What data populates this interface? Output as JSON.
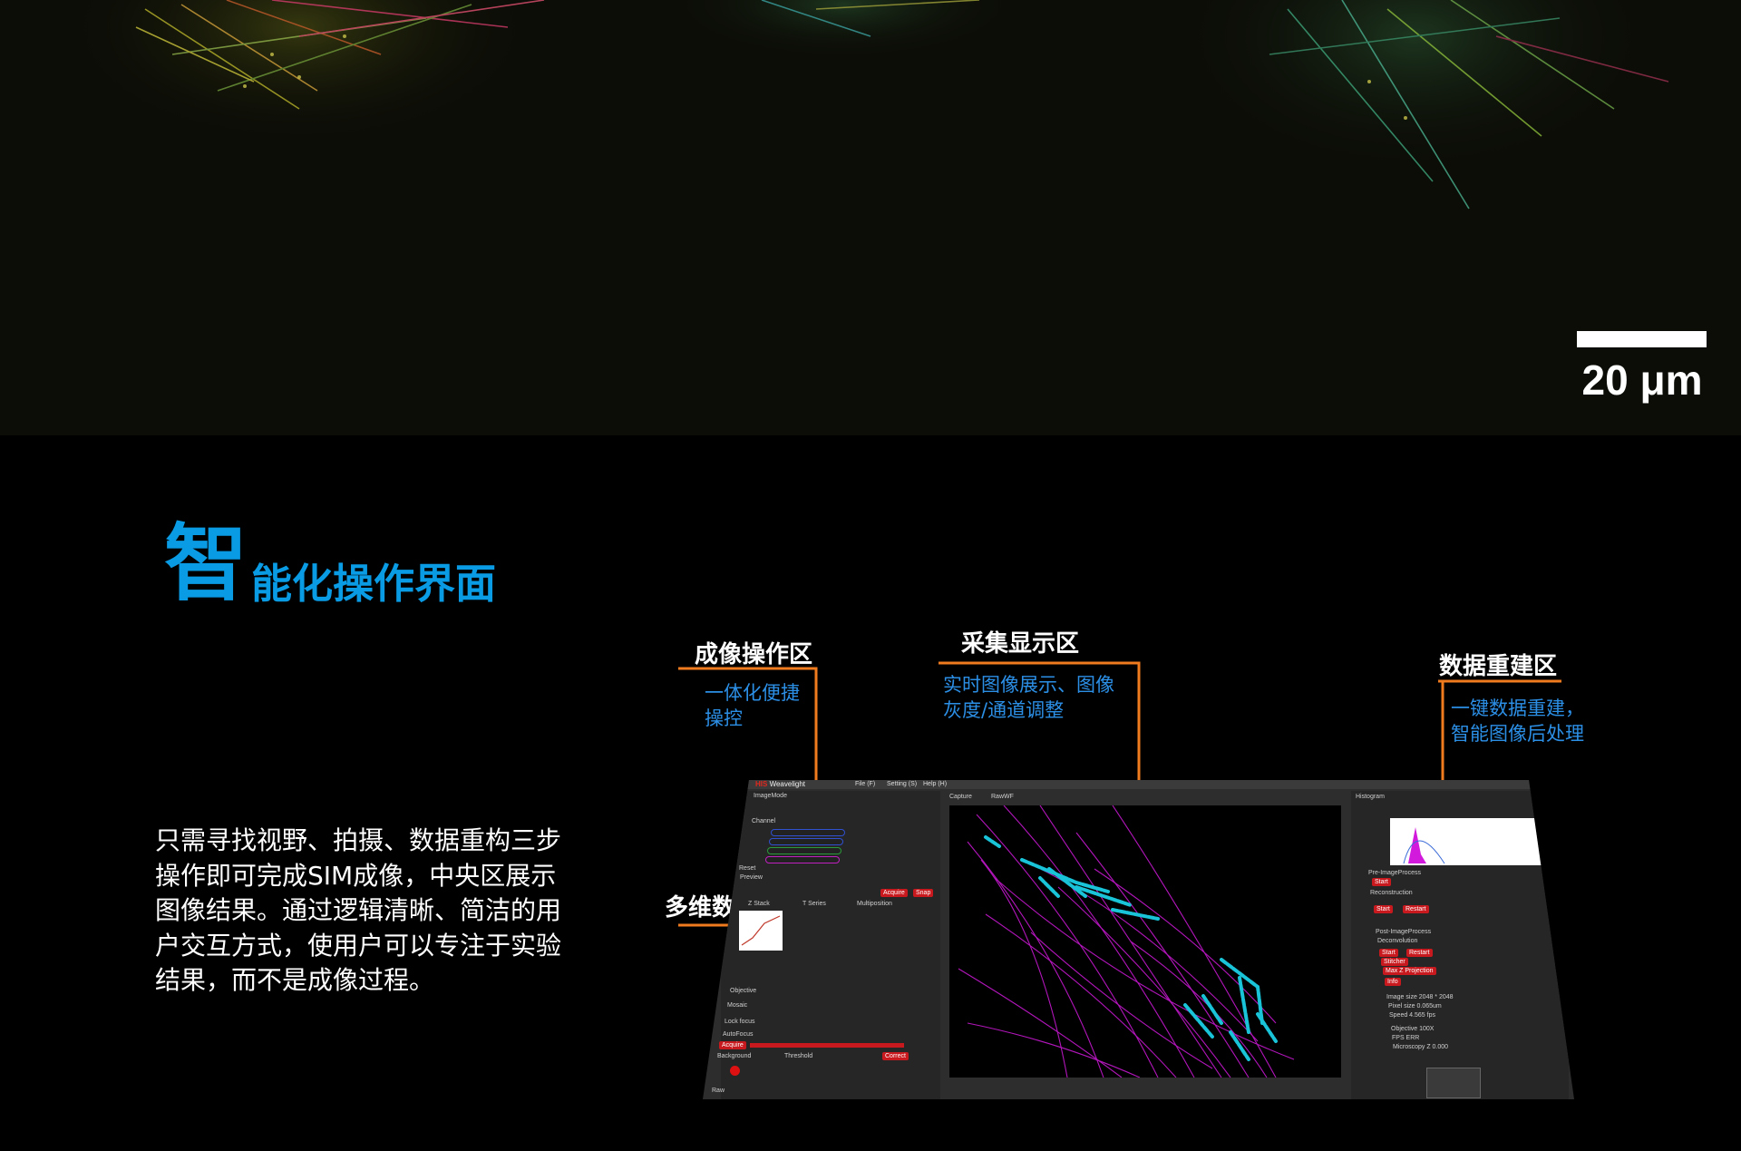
{
  "hero": {
    "scale_bar_label": "20 μm"
  },
  "heading": {
    "big_char": "智",
    "rest": "能化操作界面"
  },
  "description": "只需寻找视野、拍摄、数据重构三步操作即可完成SIM成像，中央区展示图像结果。通过逻辑清晰、简洁的用户交互方式，使用户可以专注于实验结果，而不是成像过程。",
  "callouts": [
    {
      "title": "成像操作区",
      "desc": "一体化便捷\n操控"
    },
    {
      "title": "采集显示区",
      "desc": "实时图像展示、图像\n灰度/通道调整"
    },
    {
      "title": "数据重建区",
      "desc": "一键数据重建，\n智能图像后处理"
    },
    {
      "title": "多维数据采集区",
      "desc": ""
    }
  ],
  "colors": {
    "accent_blue": "#0a9be5",
    "callout_blue": "#2c8fe6",
    "leader_orange": "#f07b1e",
    "button_red": "#c8191e",
    "specimen_magenta": "#d21adc",
    "specimen_cyan": "#19c3d8"
  },
  "software": {
    "brand_red": "HIS",
    "brand_rest": "Weavelight",
    "menus": [
      "File (F)",
      "Setting (S)",
      "Help (H)"
    ],
    "left_labels": [
      "ImageMode",
      "Channel",
      "Preview",
      "Reset",
      "Z Stack",
      "T Series",
      "Multiposition",
      "Objective",
      "Mosaic",
      "Lock focus",
      "AutoFocus",
      "Background",
      "Threshold"
    ],
    "left_buttons": [
      "Acquire",
      "Snap",
      "Acquire",
      "Correct"
    ],
    "display_tabs": [
      "Capture",
      "RawWF"
    ],
    "status_label": "Raw",
    "right_labels": [
      "Histogram",
      "Pre-ImageProcess",
      "Reconstruction",
      "Post-ImageProcess",
      "Deconvolution",
      "Info"
    ],
    "right_buttons": [
      "Start",
      "Start",
      "Restart",
      "Start",
      "Restart",
      "Stitcher",
      "Max Z Projection"
    ],
    "info_rows": [
      "Image size 2048 * 2048",
      "Pixel size 0.065um",
      "Speed 4.565 fps",
      "Objective 100X",
      "FPS ERR",
      "Microscopy Z 0.000"
    ]
  }
}
